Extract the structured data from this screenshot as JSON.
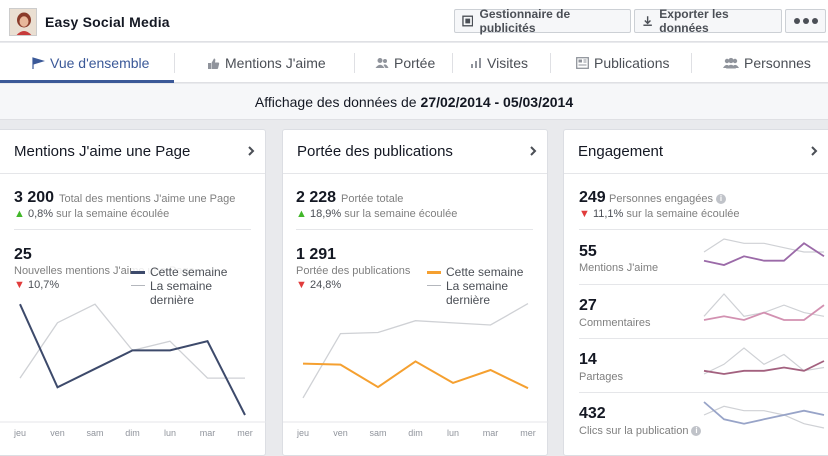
{
  "app": {
    "title": "Easy Social Media"
  },
  "header": {
    "ads_manager_label": "Gestionnaire de publicités",
    "export_label": "Exporter les données"
  },
  "nav": {
    "tabs": [
      {
        "label": "Vue d'ensemble",
        "icon": "flag-icon",
        "active": true
      },
      {
        "label": "Mentions J'aime",
        "icon": "thumbs-up-icon"
      },
      {
        "label": "Portée",
        "icon": "people-icon"
      },
      {
        "label": "Visites",
        "icon": "bar-chart-icon"
      },
      {
        "label": "Publications",
        "icon": "posts-icon"
      },
      {
        "label": "Personnes",
        "icon": "group-icon"
      }
    ]
  },
  "date_range": {
    "prefix": "Affichage des données de",
    "range": "27/02/2014 - 05/03/2014"
  },
  "colors": {
    "accent": "#3b5998",
    "up": "#42b72a",
    "down": "#e13c3c",
    "orange": "#f5a030",
    "navy": "#3d4a6b",
    "gray_line": "#cfd1d5"
  },
  "cards": {
    "likes": {
      "title": "Mentions J'aime une Page",
      "total_value": "3 200",
      "total_label": "Total des mentions J'aime une Page",
      "total_change": "0,8%",
      "total_change_suffix": "sur la semaine écoulée",
      "new_value": "25",
      "new_label": "Nouvelles mentions J'aime une Page",
      "new_change": "10,7%",
      "legend_this_week": "Cette semaine",
      "legend_last_week": "La semaine dernière"
    },
    "reach": {
      "title": "Portée des publications",
      "total_value": "2 228",
      "total_label": "Portée totale",
      "total_change": "18,9%",
      "total_change_suffix": "sur la semaine écoulée",
      "sub_value": "1 291",
      "sub_label": "Portée des publications",
      "sub_change": "24,8%",
      "legend_this_week": "Cette semaine",
      "legend_last_week": "La semaine dernière"
    },
    "engagement": {
      "title": "Engagement",
      "total_value": "249",
      "total_label": "Personnes engagées",
      "total_change": "11,1%",
      "total_change_suffix": "sur la semaine écoulée",
      "metrics": [
        {
          "value": "55",
          "label": "Mentions J'aime"
        },
        {
          "value": "27",
          "label": "Commentaires"
        },
        {
          "value": "14",
          "label": "Partages"
        },
        {
          "value": "432",
          "label": "Clics sur la publication"
        }
      ]
    }
  },
  "chart_data": [
    {
      "type": "line",
      "categories": [
        "jeu",
        "ven",
        "sam",
        "dim",
        "lun",
        "mar",
        "mer"
      ],
      "series": [
        {
          "name": "Cette semaine",
          "values": [
            6,
            1.5,
            2.5,
            3.5,
            3.5,
            4,
            0
          ]
        },
        {
          "name": "La semaine dernière",
          "values": [
            2,
            5,
            6,
            3.5,
            4,
            2,
            2
          ]
        }
      ]
    },
    {
      "type": "line",
      "categories": [
        "jeu",
        "ven",
        "sam",
        "dim",
        "lun",
        "mar",
        "mer"
      ],
      "series": [
        {
          "name": "Cette semaine",
          "values": [
            240,
            235,
            130,
            250,
            150,
            210,
            125
          ]
        },
        {
          "name": "La semaine dernière",
          "values": [
            80,
            380,
            385,
            440,
            430,
            420,
            520
          ]
        }
      ]
    },
    {
      "type": "line",
      "label": "Mentions J'aime",
      "series": [
        {
          "values": [
            5,
            4,
            6,
            5,
            5,
            9,
            6
          ]
        },
        {
          "values": [
            7,
            10,
            9,
            9,
            8,
            7,
            7
          ]
        }
      ]
    },
    {
      "type": "line",
      "label": "Commentaires",
      "series": [
        {
          "values": [
            2,
            3,
            2,
            4,
            2,
            2,
            6
          ]
        },
        {
          "values": [
            3,
            9,
            3,
            4,
            6,
            4,
            3
          ]
        }
      ]
    },
    {
      "type": "line",
      "label": "Partages",
      "series": [
        {
          "values": [
            3,
            2,
            3,
            3,
            4,
            3,
            6
          ]
        },
        {
          "values": [
            2,
            5,
            10,
            5,
            8,
            3,
            4
          ]
        }
      ]
    },
    {
      "type": "line",
      "label": "Clics sur la publication",
      "series": [
        {
          "values": [
            8,
            4,
            3,
            4,
            5,
            6,
            5
          ]
        },
        {
          "values": [
            5,
            7,
            6,
            6,
            5,
            3,
            2
          ]
        }
      ]
    }
  ]
}
